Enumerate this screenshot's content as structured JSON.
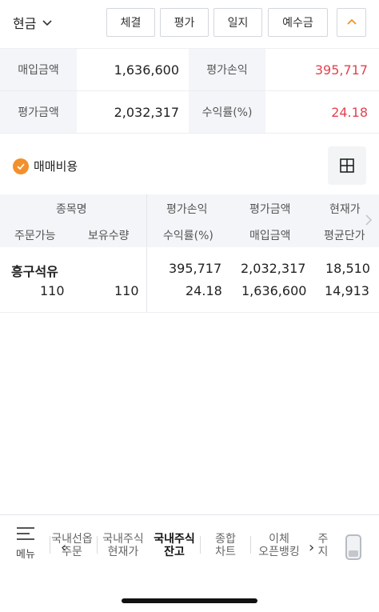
{
  "header": {
    "account_type": "현금",
    "buttons": [
      "체결",
      "평가",
      "일지",
      "예수금"
    ]
  },
  "summary": {
    "purchase_label": "매입금액",
    "purchase_value": "1,636,600",
    "eval_pl_label": "평가손익",
    "eval_pl_value": "395,717",
    "eval_amt_label": "평가금액",
    "eval_amt_value": "2,032,317",
    "return_label": "수익률(%)",
    "return_value": "24.18"
  },
  "fee_toggle": {
    "label": "매매비용",
    "checked": true
  },
  "table": {
    "headers_row1": [
      "종목명",
      "평가손익",
      "평가금액",
      "현재가"
    ],
    "headers_row2": [
      "주문가능",
      "보유수량",
      "수익률(%)",
      "매입금액",
      "평균단가"
    ],
    "rows": [
      {
        "name": "흥구석유",
        "eval_pl": "395,717",
        "eval_amt": "2,032,317",
        "current_price": "18,510",
        "orderable": "110",
        "holding": "110",
        "return_rate": "24.18",
        "purchase_amt": "1,636,600",
        "avg_price": "14,913"
      }
    ]
  },
  "bottom_nav": {
    "menu_label": "메뉴",
    "items": [
      {
        "line1": "국내선옵",
        "line2": "주문"
      },
      {
        "line1": "국내주식",
        "line2": "현재가"
      },
      {
        "line1": "국내주식",
        "line2": "잔고"
      },
      {
        "line1": "종합",
        "line2": "차트"
      },
      {
        "line1": "이체",
        "line2": "오픈뱅킹"
      },
      {
        "line1": "주",
        "line2": "지"
      }
    ]
  },
  "colors": {
    "positive": "#e2434f",
    "accent": "#f3902b"
  }
}
